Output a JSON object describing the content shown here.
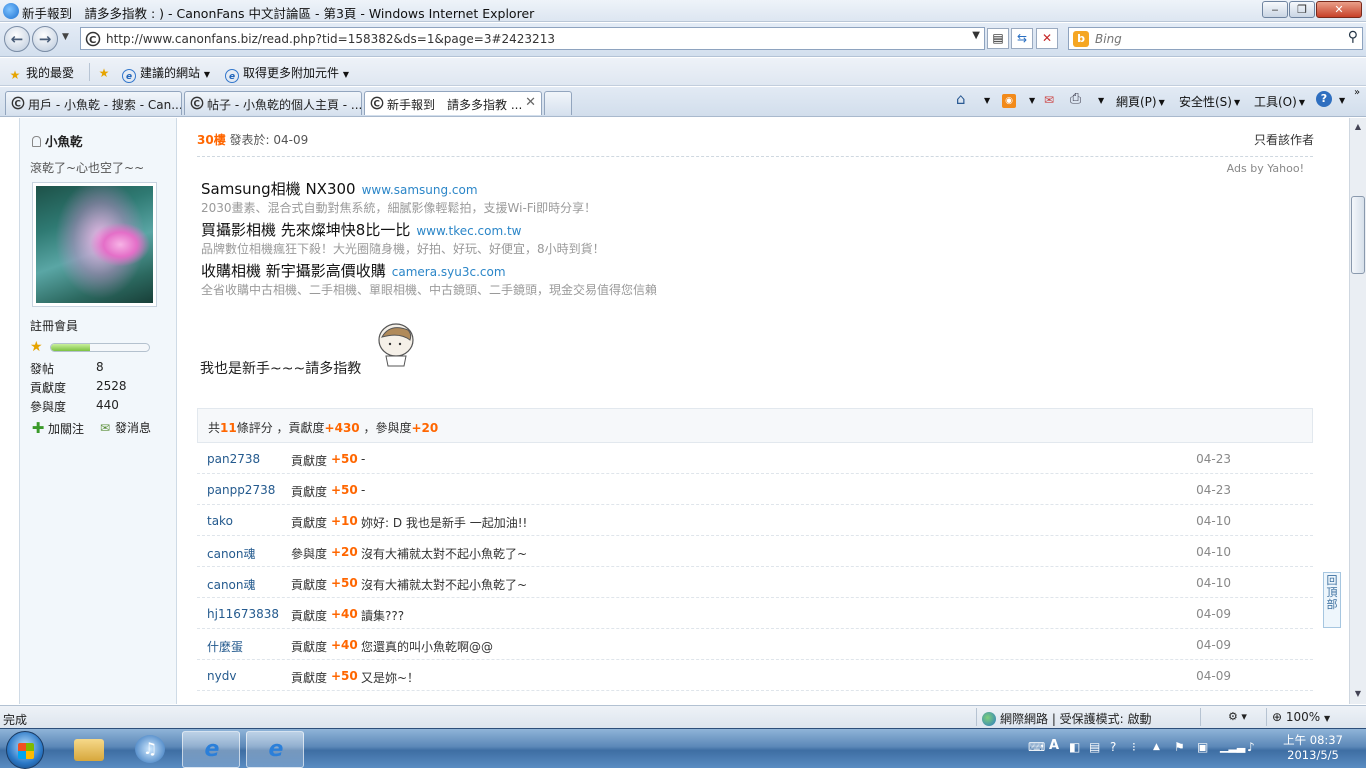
{
  "window": {
    "title": "新手報到　請多多指教 : ) - CanonFans 中文討論區 - 第3頁 - Windows Internet Explorer",
    "minimize": "‒",
    "maximize": "❐",
    "close": "✕"
  },
  "address": {
    "url": "http://www.canonfans.biz/read.php?tid=158382&ds=1&page=3#2423213",
    "search_placeholder": "Bing"
  },
  "favorites": {
    "favorites_label": "我的最愛",
    "suggested_sites": "建議的網站",
    "get_addons": "取得更多附加元件"
  },
  "tabs": [
    {
      "label": "用戶 - 小魚乾 - 搜索 - Can...",
      "active": false
    },
    {
      "label": "帖子 - 小魚乾的個人主頁 - ...",
      "active": false
    },
    {
      "label": "新手報到　請多多指教 ...",
      "active": true
    }
  ],
  "commandbar": {
    "page": "網頁(P)",
    "safety": "安全性(S)",
    "tools": "工具(O)"
  },
  "sidebar": {
    "username": "小魚乾",
    "signature": "滾乾了~心也空了~~",
    "role": "註冊會員",
    "level_progress": 0.4,
    "stats": [
      {
        "label": "發帖",
        "value": "8"
      },
      {
        "label": "貢獻度",
        "value": "2528"
      },
      {
        "label": "參與度",
        "value": "440"
      }
    ],
    "follow": "加關注",
    "message": "發消息"
  },
  "post": {
    "floor": "30樓",
    "posted_at": "發表於: 04-09",
    "only_author": "只看該作者",
    "ads_by": "Ads by Yahoo!",
    "ads": [
      {
        "title": "Samsung相機 NX300",
        "url": "www.samsung.com",
        "desc": "2030畫素、混合式自動對焦系統，細膩影像輕鬆拍，支援Wi-Fi即時分享！"
      },
      {
        "title": "買攝影相機 先來燦坤快8比一比",
        "url": "www.tkec.com.tw",
        "desc": "品牌數位相機瘋狂下殺！大光圈隨身機，好拍、好玩、好便宜，8小時到貨！"
      },
      {
        "title": "收購相機 新宇攝影高價收購",
        "url": "camera.syu3c.com",
        "desc": "全省收購中古相機、二手相機、單眼相機、中古鏡頭、二手鏡頭，現金交易值得您信賴"
      }
    ],
    "message": "我也是新手~~~請多指教"
  },
  "rating": {
    "prefix": "共",
    "count": "11",
    "mid1": "條評分 ，貢獻度",
    "contrib": "+430",
    "mid2": " ，參與度",
    "particip": "+20",
    "rows": [
      {
        "user": "pan2738",
        "type": "貢獻度",
        "value": "+50",
        "comment": "-",
        "date": "04-23"
      },
      {
        "user": "panpp2738",
        "type": "貢獻度",
        "value": "+50",
        "comment": "-",
        "date": "04-23"
      },
      {
        "user": "tako",
        "type": "貢獻度",
        "value": "+10",
        "comment": "妳好: D 我也是新手  一起加油!!",
        "date": "04-10"
      },
      {
        "user": "canon魂",
        "type": "參與度",
        "value": "+20",
        "comment": "沒有大補就太對不起小魚乾了~",
        "date": "04-10"
      },
      {
        "user": "canon魂",
        "type": "貢獻度",
        "value": "+50",
        "comment": "沒有大補就太對不起小魚乾了~",
        "date": "04-10"
      },
      {
        "user": "hj11673838",
        "type": "貢獻度",
        "value": "+40",
        "comment": "讀集???",
        "date": "04-09"
      },
      {
        "user": "什麼蛋",
        "type": "貢獻度",
        "value": "+40",
        "comment": "您還真的叫小魚乾啊@@",
        "date": "04-09"
      },
      {
        "user": "nydv",
        "type": "貢獻度",
        "value": "+50",
        "comment": "又是妳~！",
        "date": "04-09"
      }
    ]
  },
  "backtop": "回頂部",
  "status": {
    "left": "完成",
    "zone": "網際網路 | 受保護模式: 啟動",
    "zoom": "100%"
  },
  "clock": {
    "time": "上午 08:37",
    "date": "2013/5/5"
  }
}
